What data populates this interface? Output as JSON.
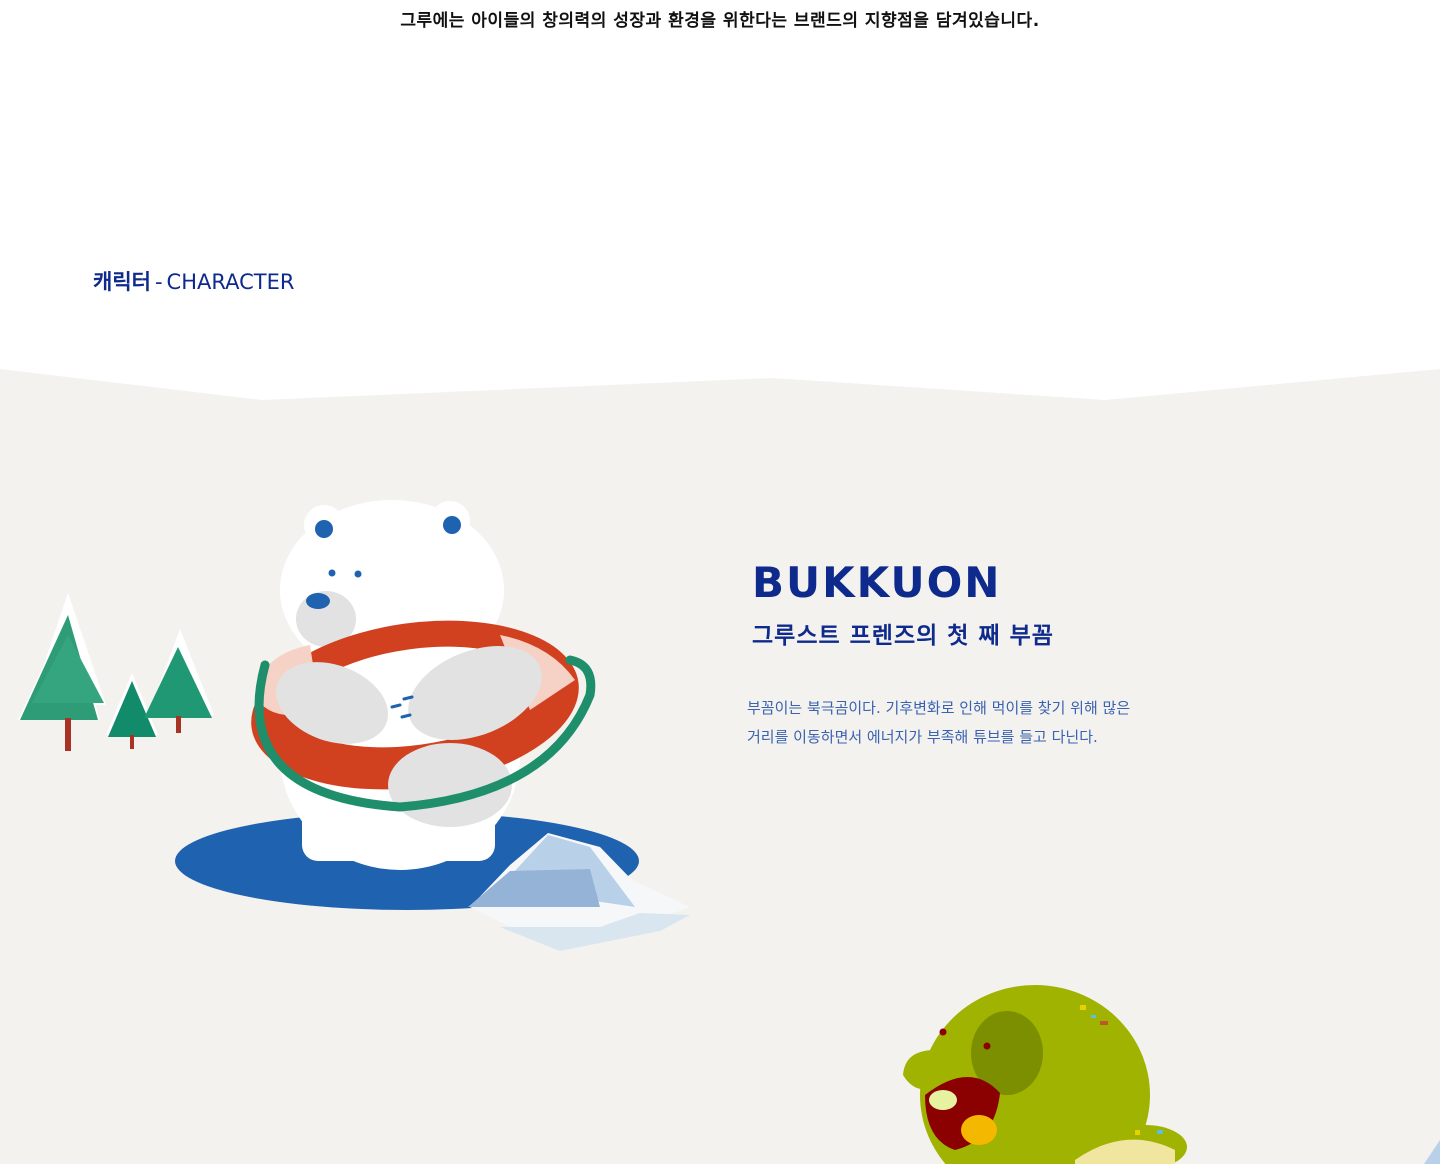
{
  "intro": {
    "text": "그루에는 아이들의 창의력의 성장과 환경을 위한다는 브랜드의 지향점을 담겨있습니다."
  },
  "section": {
    "title_ko": "캐릭터",
    "separator": "-",
    "title_en": "CHARACTER"
  },
  "character": {
    "name": "BUKKUON",
    "tagline": "그루스트 프렌즈의 첫 째 부꼼",
    "description": "부꼼이는 북극곰이다. 기후변화로 인해 먹이를 찾기 위해 많은 거리를 이동하면서 에너지가 부족해 튜브를 들고 다닌다."
  },
  "colors": {
    "brand_navy": "#0e2a8c",
    "description_blue": "#3a62b0",
    "stage_background": "#f3f2ef",
    "water_blue": "#1f62b0",
    "tree_green": "#2f9c78",
    "turtle_green": "#9fb300"
  }
}
